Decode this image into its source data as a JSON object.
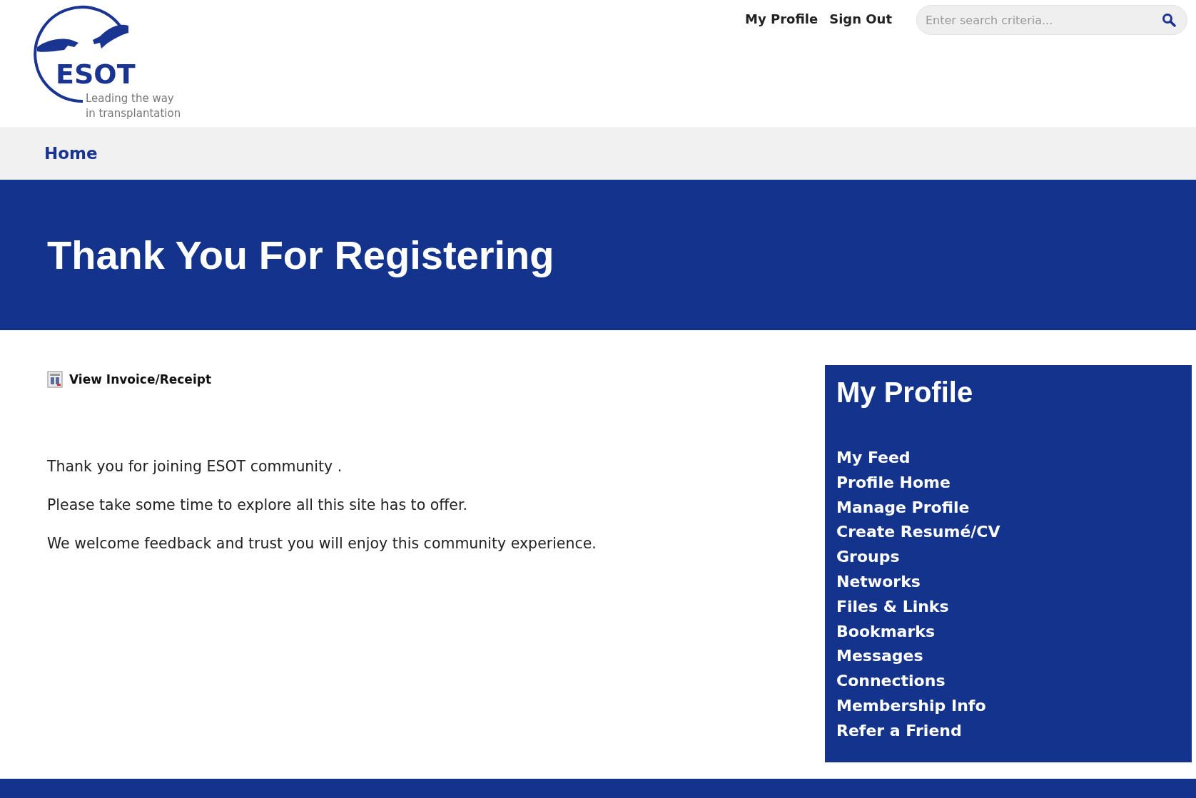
{
  "logo": {
    "name": "ESOT",
    "tagline": [
      "Leading the way",
      "in transplantation"
    ]
  },
  "header_links": [
    "My Profile",
    "Sign Out"
  ],
  "search": {
    "placeholder": "Enter search criteria..."
  },
  "nav": {
    "items": [
      "Home"
    ]
  },
  "banner": {
    "title": "Thank You For Registering"
  },
  "invoice_link": "View Invoice/Receipt",
  "paragraphs": [
    "Thank you for joining ESOT community .",
    "Please take some time to explore all this site has to offer.",
    "We welcome feedback and trust you will enjoy this community experience."
  ],
  "sidebar": {
    "title": "My Profile",
    "items": [
      "My Feed",
      "Profile Home",
      "Manage Profile",
      "Create Resumé/CV",
      "Groups",
      "Networks",
      "Files & Links",
      "Bookmarks",
      "Messages",
      "Connections",
      "Membership Info",
      "Refer a Friend"
    ]
  }
}
